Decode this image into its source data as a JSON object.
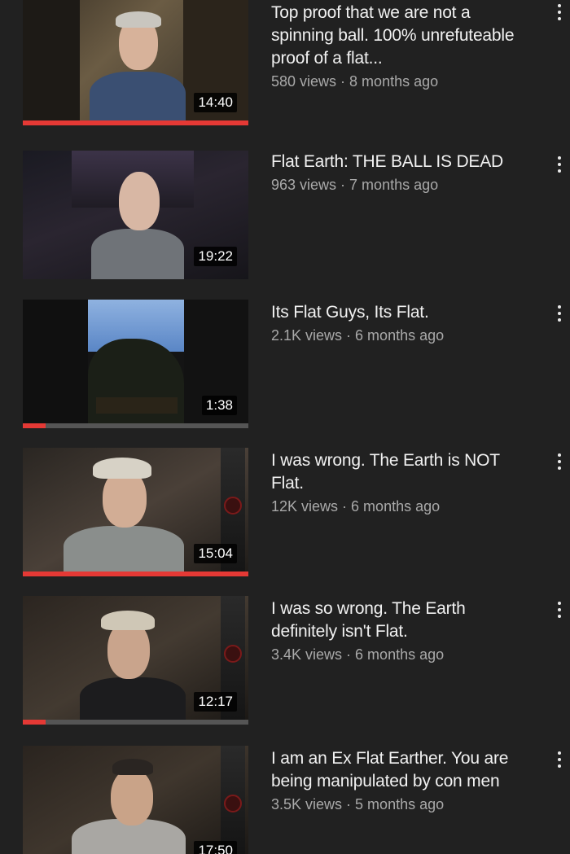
{
  "videos": [
    {
      "title": "Top proof that we are not a spinning ball. 100% unrefuteable proof of a flat...",
      "views": "580 views",
      "age": "8 months ago",
      "duration": "14:40",
      "progress": 1.0
    },
    {
      "title": "Flat Earth: THE BALL IS DEAD",
      "views": "963 views",
      "age": "7 months ago",
      "duration": "19:22",
      "progress": 0
    },
    {
      "title": "Its Flat Guys, Its Flat.",
      "views": "2.1K views",
      "age": "6 months ago",
      "duration": "1:38",
      "progress": 0.1
    },
    {
      "title": "I was wrong. The Earth is NOT Flat.",
      "views": "12K views",
      "age": "6 months ago",
      "duration": "15:04",
      "progress": 1.0
    },
    {
      "title": "I was so wrong. The Earth definitely isn't Flat.",
      "views": "3.4K views",
      "age": "6 months ago",
      "duration": "12:17",
      "progress": 0.1
    },
    {
      "title": "I am an Ex Flat Earther. You are being manipulated by con men",
      "views": "3.5K views",
      "age": "5 months ago",
      "duration": "17:50",
      "progress": 0
    }
  ],
  "separator": " · ",
  "colors": {
    "background": "#212121",
    "progress": "#e53935",
    "meta_text": "#a9a9a9"
  },
  "icons": {
    "menu": "more-vertical-icon"
  }
}
